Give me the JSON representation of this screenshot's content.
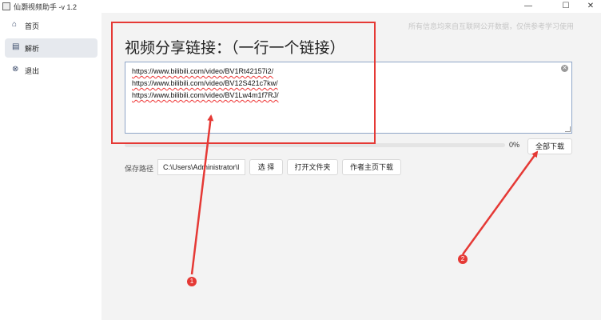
{
  "window": {
    "title": "仙灏视频助手 -v 1.2",
    "controls": {
      "minimize": "—",
      "maximize": "☐",
      "close": "✕"
    }
  },
  "sidebar": {
    "items": [
      {
        "icon": "home-icon",
        "label": "首页",
        "active": false
      },
      {
        "icon": "parse-icon",
        "label": "解析",
        "active": true
      },
      {
        "icon": "exit-icon",
        "label": "退出",
        "active": false
      }
    ]
  },
  "disclaimer": "所有信息均来自互联网公开数据，仅供参考学习使用",
  "main": {
    "heading": "视频分享链接：（一行一个链接）",
    "links": [
      "https://www.bilibili.com/video/BV1Rt42157i2/",
      "https://www.bilibili.com/video/BV12S421c7kw/",
      "https://www.bilibili.com/video/BV1Lw4m1f7RJ/"
    ],
    "progress": {
      "value": 0,
      "label": "0%"
    },
    "download_all_label": "全部下载",
    "save_path_label": "保存路径",
    "save_path_value": "C:\\Users\\Administrator\\I",
    "choose_label": "选 择",
    "open_folder_label": "打开文件夹",
    "author_download_label": "作者主页下载"
  },
  "annotations": {
    "badge1": "1",
    "badge2": "2",
    "color": "#e53935"
  }
}
